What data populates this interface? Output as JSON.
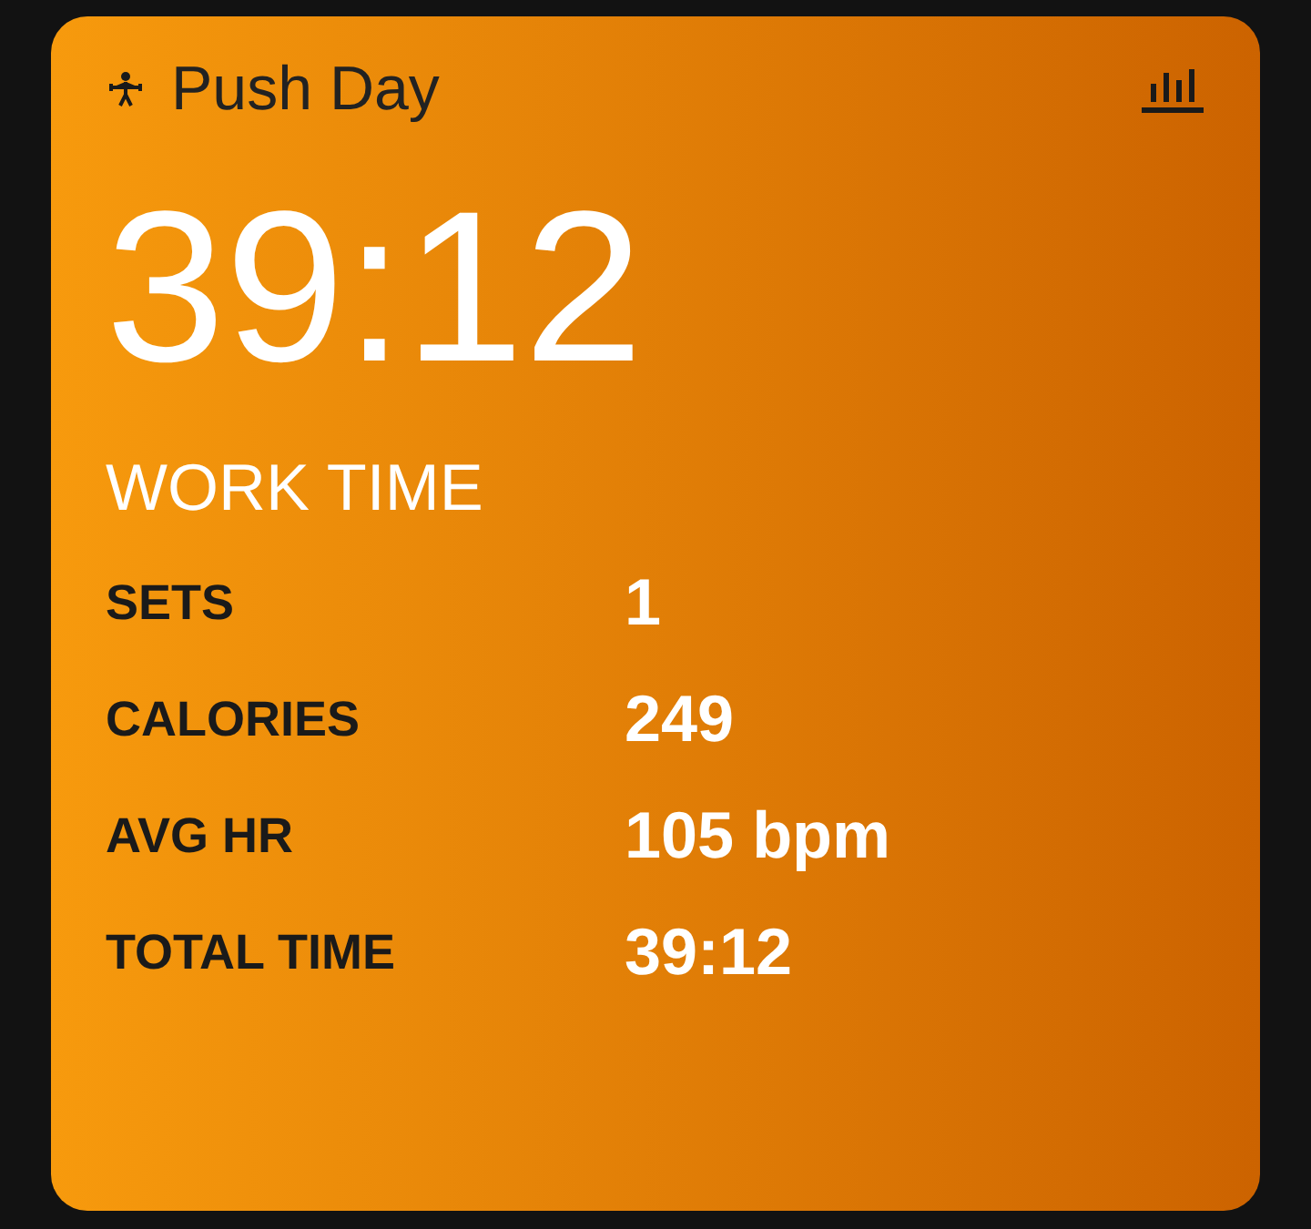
{
  "card": {
    "title": "Push Day",
    "time": "39:12",
    "time_label": "WORK TIME"
  },
  "stats": [
    {
      "label": "SETS",
      "value": "1"
    },
    {
      "label": "CALORIES",
      "value": "249"
    },
    {
      "label": "AVG HR",
      "value": "105 bpm"
    },
    {
      "label": "TOTAL TIME",
      "value": "39:12"
    }
  ]
}
